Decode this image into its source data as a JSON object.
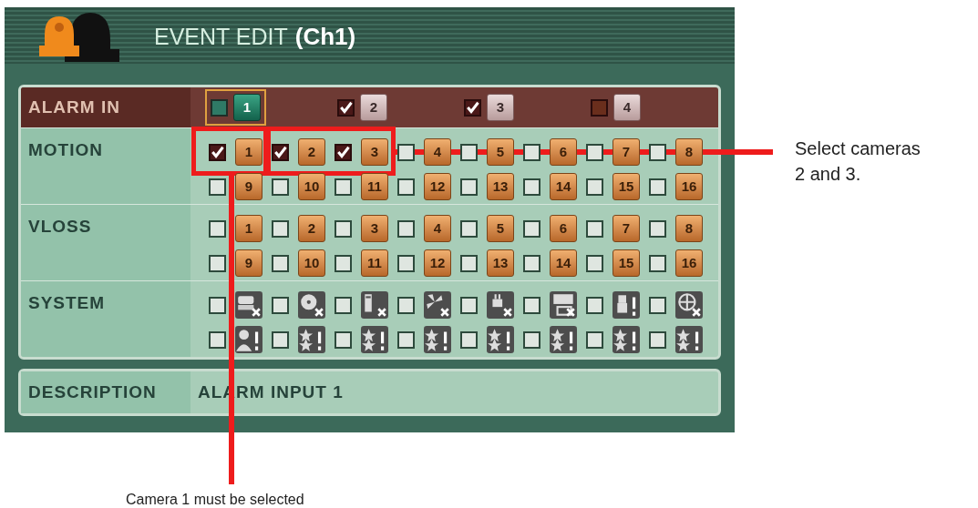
{
  "window": {
    "title": "EVENT EDIT",
    "channel": "(Ch1)"
  },
  "alarm_in": {
    "label": "ALARM IN",
    "items": [
      {
        "label": "1",
        "checked": false,
        "selected": true
      },
      {
        "label": "2",
        "checked": true,
        "selected": false
      },
      {
        "label": "3",
        "checked": true,
        "selected": false
      },
      {
        "label": "4",
        "checked": false,
        "selected": false
      }
    ]
  },
  "sections": [
    {
      "label": "MOTION",
      "kind": "numbers",
      "items": [
        {
          "label": "1",
          "checked": true
        },
        {
          "label": "2",
          "checked": true
        },
        {
          "label": "3",
          "checked": true
        },
        {
          "label": "4",
          "checked": false
        },
        {
          "label": "5",
          "checked": false
        },
        {
          "label": "6",
          "checked": false
        },
        {
          "label": "7",
          "checked": false
        },
        {
          "label": "8",
          "checked": false
        },
        {
          "label": "9",
          "checked": false
        },
        {
          "label": "10",
          "checked": false
        },
        {
          "label": "11",
          "checked": false
        },
        {
          "label": "12",
          "checked": false
        },
        {
          "label": "13",
          "checked": false
        },
        {
          "label": "14",
          "checked": false
        },
        {
          "label": "15",
          "checked": false
        },
        {
          "label": "16",
          "checked": false
        }
      ]
    },
    {
      "label": "VLOSS",
      "kind": "numbers",
      "items": [
        {
          "label": "1",
          "checked": false
        },
        {
          "label": "2",
          "checked": false
        },
        {
          "label": "3",
          "checked": false
        },
        {
          "label": "4",
          "checked": false
        },
        {
          "label": "5",
          "checked": false
        },
        {
          "label": "6",
          "checked": false
        },
        {
          "label": "7",
          "checked": false
        },
        {
          "label": "8",
          "checked": false
        },
        {
          "label": "9",
          "checked": false
        },
        {
          "label": "10",
          "checked": false
        },
        {
          "label": "11",
          "checked": false
        },
        {
          "label": "12",
          "checked": false
        },
        {
          "label": "13",
          "checked": false
        },
        {
          "label": "14",
          "checked": false
        },
        {
          "label": "15",
          "checked": false
        },
        {
          "label": "16",
          "checked": false
        }
      ]
    },
    {
      "label": "SYSTEM",
      "kind": "icons",
      "items": [
        {
          "checked": false
        },
        {
          "checked": false
        },
        {
          "checked": false
        },
        {
          "checked": false
        },
        {
          "checked": false
        },
        {
          "checked": false
        },
        {
          "checked": false
        },
        {
          "checked": false
        },
        {
          "checked": false
        },
        {
          "checked": false
        },
        {
          "checked": false
        },
        {
          "checked": false
        },
        {
          "checked": false
        },
        {
          "checked": false
        },
        {
          "checked": false
        },
        {
          "checked": false
        }
      ]
    }
  ],
  "description": {
    "label": "DESCRIPTION",
    "value": "ALARM INPUT 1"
  },
  "callouts": [
    {
      "text": "Select cameras 2 and 3."
    },
    {
      "text": "Camera 1 must be selected"
    }
  ]
}
